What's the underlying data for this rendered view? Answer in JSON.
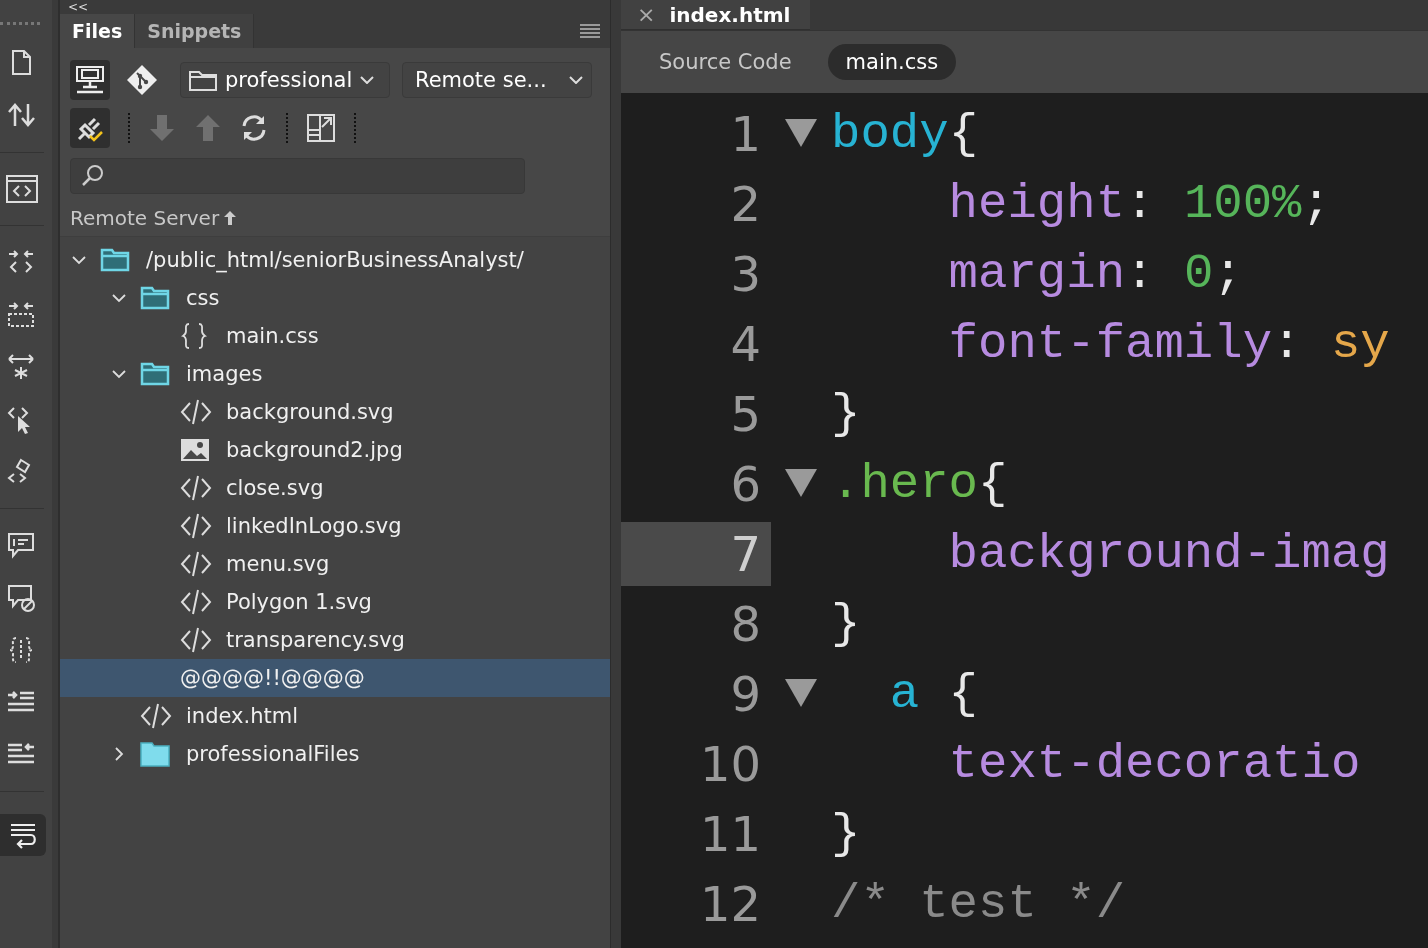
{
  "collapse_button": {
    "label": "<<"
  },
  "panel_tabs": [
    {
      "label": "Files",
      "selected": true
    },
    {
      "label": "Snippets",
      "selected": false
    }
  ],
  "site_dropdown": {
    "value": "professional"
  },
  "view_dropdown": {
    "value": "Remote se..."
  },
  "transfer_buttons": [
    {
      "kind": "download",
      "disabled": true
    },
    {
      "kind": "upload",
      "disabled": true
    },
    {
      "kind": "refresh",
      "disabled": false
    }
  ],
  "column_header": {
    "label": "Remote Server"
  },
  "tree": [
    {
      "name": "/public_html/seniorBusinessAnalyst/",
      "kind": "folder",
      "expanded": true,
      "selected": false,
      "children": [
        {
          "name": "css",
          "kind": "folder",
          "expanded": true,
          "selected": false,
          "children": [
            {
              "name": "main.css",
              "kind": "css",
              "selected": false
            }
          ]
        },
        {
          "name": "images",
          "kind": "folder",
          "expanded": true,
          "selected": false,
          "children": [
            {
              "name": "background.svg",
              "kind": "code",
              "selected": false
            },
            {
              "name": "background2.jpg",
              "kind": "image",
              "selected": false
            },
            {
              "name": "close.svg",
              "kind": "code",
              "selected": false
            },
            {
              "name": "linkedInLogo.svg",
              "kind": "code",
              "selected": false
            },
            {
              "name": "menu.svg",
              "kind": "code",
              "selected": false
            },
            {
              "name": "Polygon 1.svg",
              "kind": "code",
              "selected": false
            },
            {
              "name": "transparency.svg",
              "kind": "code",
              "selected": false
            },
            {
              "name": "@@@@!!@@@@",
              "kind": "none",
              "selected": true
            }
          ]
        },
        {
          "name": "index.html",
          "kind": "code",
          "selected": false
        },
        {
          "name": "professionalFiles",
          "kind": "folder",
          "expanded": false,
          "selected": false
        }
      ]
    }
  ],
  "document_tab": {
    "label": "index.html",
    "close": "×"
  },
  "related_files": [
    {
      "label": "Source Code",
      "selected": false
    },
    {
      "label": "main.css",
      "selected": true
    }
  ],
  "code_lines": [
    {
      "number": "1",
      "fold": true,
      "current": false,
      "tokens": [
        {
          "text": "body",
          "kind": "selector"
        },
        {
          "text": "{",
          "kind": "punct"
        }
      ]
    },
    {
      "number": "2",
      "fold": false,
      "current": false,
      "tokens": [
        {
          "text": "    height",
          "kind": "property"
        },
        {
          "text": ": ",
          "kind": "punct"
        },
        {
          "text": "100%",
          "kind": "number"
        },
        {
          "text": ";",
          "kind": "punct"
        }
      ]
    },
    {
      "number": "3",
      "fold": false,
      "current": false,
      "tokens": [
        {
          "text": "    margin",
          "kind": "property"
        },
        {
          "text": ": ",
          "kind": "punct"
        },
        {
          "text": "0",
          "kind": "number"
        },
        {
          "text": ";",
          "kind": "punct"
        }
      ]
    },
    {
      "number": "4",
      "fold": false,
      "current": false,
      "tokens": [
        {
          "text": "    font-family",
          "kind": "property"
        },
        {
          "text": ": ",
          "kind": "punct"
        },
        {
          "text": "sy",
          "kind": "value"
        }
      ]
    },
    {
      "number": "5",
      "fold": false,
      "current": false,
      "tokens": [
        {
          "text": "}",
          "kind": "punct"
        }
      ]
    },
    {
      "number": "6",
      "fold": true,
      "current": false,
      "tokens": [
        {
          "text": ".hero",
          "kind": "class"
        },
        {
          "text": "{",
          "kind": "punct"
        }
      ]
    },
    {
      "number": "7",
      "fold": false,
      "current": true,
      "tokens": [
        {
          "text": "    background-imag",
          "kind": "property"
        }
      ]
    },
    {
      "number": "8",
      "fold": false,
      "current": false,
      "tokens": [
        {
          "text": "}",
          "kind": "punct"
        }
      ]
    },
    {
      "number": "9",
      "fold": true,
      "current": false,
      "tokens": [
        {
          "text": "  a",
          "kind": "selector"
        },
        {
          "text": " {",
          "kind": "punct"
        }
      ]
    },
    {
      "number": "10",
      "fold": false,
      "current": false,
      "tokens": [
        {
          "text": "    text-decoratio",
          "kind": "property"
        }
      ]
    },
    {
      "number": "11",
      "fold": false,
      "current": false,
      "tokens": [
        {
          "text": "}",
          "kind": "punct"
        }
      ]
    },
    {
      "number": "12",
      "fold": false,
      "current": false,
      "tokens": [
        {
          "text": "/* test */",
          "kind": "comment"
        }
      ]
    }
  ]
}
